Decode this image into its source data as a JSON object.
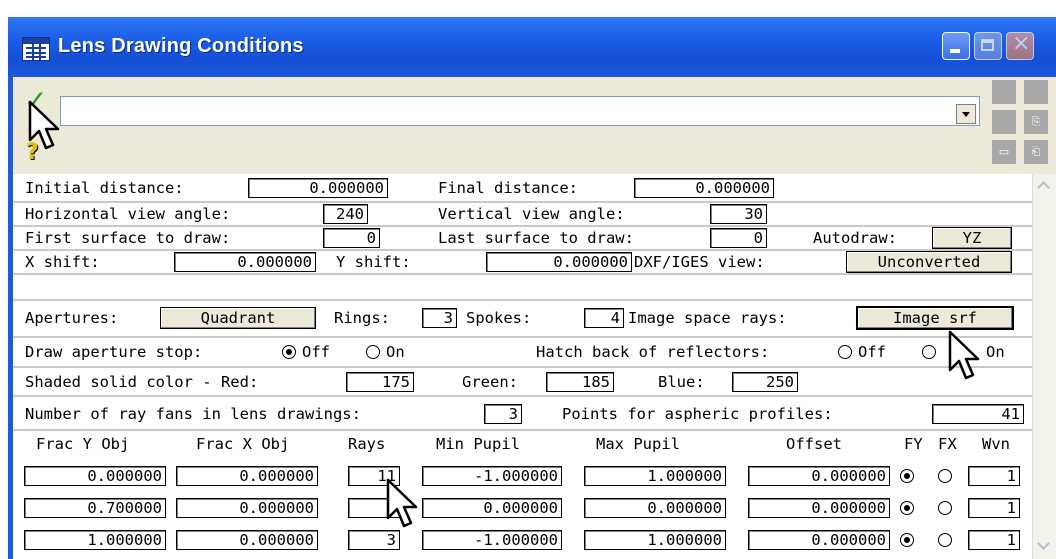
{
  "window": {
    "title": "Lens Drawing Conditions"
  },
  "toolbar": {
    "command_value": ""
  },
  "rows": {
    "r1": {
      "initial_label": "Initial distance:",
      "initial_value": "0.000000",
      "final_label": "Final distance:",
      "final_value": "0.000000"
    },
    "r2": {
      "hview_label": "Horizontal view angle:",
      "hview_value": "240",
      "vview_label": "Vertical view angle:",
      "vview_value": "30"
    },
    "r3": {
      "first_label": "First surface to draw:",
      "first_value": "0",
      "last_label": "Last surface to draw:",
      "last_value": "0",
      "autodraw_label": "Autodraw:",
      "autodraw_value": "YZ"
    },
    "r4": {
      "xshift_label": "X shift:",
      "xshift_value": "0.000000",
      "yshift_label": "Y shift:",
      "yshift_value": "0.000000",
      "dxf_label": "DXF/IGES view:",
      "dxf_value": "Unconverted"
    },
    "r5": {
      "apertures_label": "Apertures:",
      "apertures_value": "Quadrant",
      "rings_label": "Rings:",
      "rings_value": "3",
      "spokes_label": "Spokes:",
      "spokes_value": "4",
      "isr_label": "Image space rays:",
      "isr_value": "Image srf"
    },
    "r6": {
      "stop_label": "Draw aperture stop:",
      "off": "Off",
      "on": "On",
      "hatch_label": "Hatch back of reflectors:",
      "stop_selected": "Off",
      "hatch_selected": "Off"
    },
    "r7": {
      "shaded_label": "Shaded solid color - Red:",
      "red": "175",
      "green_label": "Green:",
      "green": "185",
      "blue_label": "Blue:",
      "blue": "250"
    },
    "r8": {
      "fans_label": "Number of ray fans in lens drawings:",
      "fans_value": "3",
      "points_label": "Points for aspheric profiles:",
      "points_value": "41"
    }
  },
  "fan_table": {
    "headers": [
      "Frac Y Obj",
      "Frac X Obj",
      "Rays",
      "Min Pupil",
      "Max Pupil",
      "Offset",
      "FY",
      "FX",
      "Wvn"
    ],
    "rows": [
      {
        "fy_obj": "0.000000",
        "fx_obj": "0.000000",
        "rays": "11",
        "min": "-1.000000",
        "max": "1.000000",
        "offset": "0.000000",
        "sel": "FY",
        "wvn": "1"
      },
      {
        "fy_obj": "0.700000",
        "fx_obj": "0.000000",
        "rays": "0",
        "min": "0.000000",
        "max": "0.000000",
        "offset": "0.000000",
        "sel": "FY",
        "wvn": "1"
      },
      {
        "fy_obj": "1.000000",
        "fx_obj": "0.000000",
        "rays": "3",
        "min": "-1.000000",
        "max": "1.000000",
        "offset": "0.000000",
        "sel": "FY",
        "wvn": "1"
      }
    ]
  },
  "colors": {
    "titlebar": "#1b5ce6",
    "face": "#ece9d8",
    "toolbar_tile": "#a8a8a8"
  },
  "icons": [
    "grid-icon",
    "check-icon",
    "cancel-icon",
    "help-icon",
    "minimize-icon",
    "maximize-icon",
    "close-icon",
    "copy-icon",
    "chevron-down-icon",
    "chevron-up-icon",
    "mouse-cursor-icon"
  ]
}
